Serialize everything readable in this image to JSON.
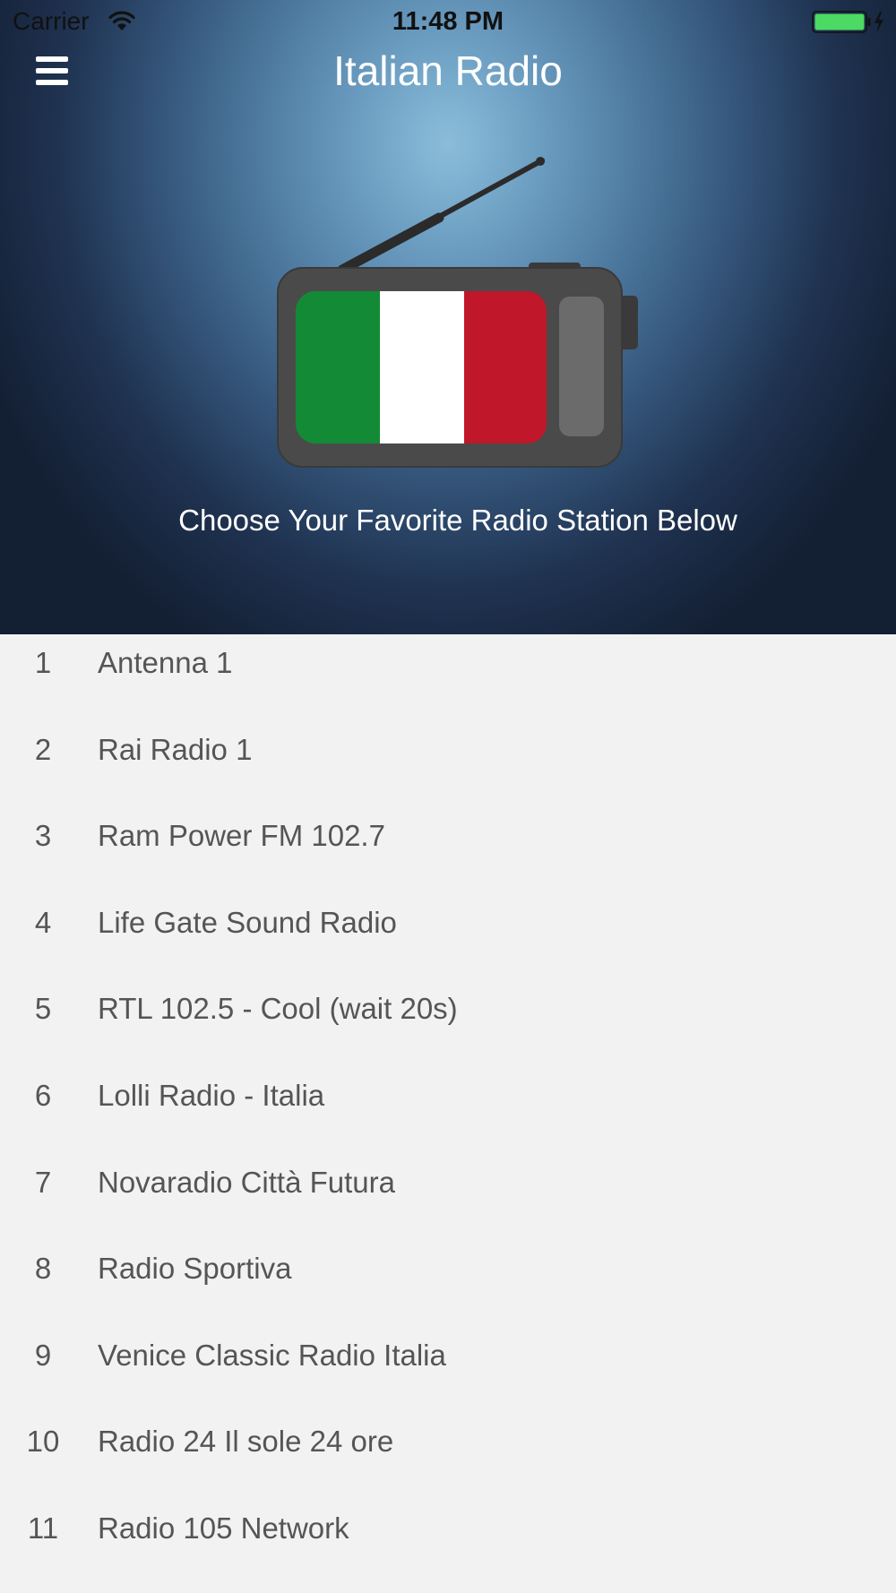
{
  "status_bar": {
    "carrier": "Carrier",
    "time": "11:48 PM",
    "battery_color": "#4cd964"
  },
  "nav": {
    "title": "Italian Radio",
    "menu_icon": "hamburger-menu-icon"
  },
  "hero": {
    "subtitle": "Choose Your Favorite Radio Station Below",
    "flag_colors": [
      "#138a36",
      "#ffffff",
      "#c0182a"
    ]
  },
  "stations": [
    {
      "num": "1",
      "name": "Antenna 1"
    },
    {
      "num": "2",
      "name": "Rai Radio 1"
    },
    {
      "num": "3",
      "name": "Ram Power FM 102.7"
    },
    {
      "num": "4",
      "name": "Life Gate Sound Radio"
    },
    {
      "num": "5",
      "name": "RTL 102.5 - Cool (wait 20s)"
    },
    {
      "num": "6",
      "name": "Lolli Radio - Italia"
    },
    {
      "num": "7",
      "name": "Novaradio Città Futura"
    },
    {
      "num": "8",
      "name": "Radio Sportiva"
    },
    {
      "num": "9",
      "name": "Venice Classic Radio Italia"
    },
    {
      "num": "10",
      "name": "Radio 24 Il sole 24 ore"
    },
    {
      "num": "11",
      "name": "Radio 105 Network"
    }
  ]
}
